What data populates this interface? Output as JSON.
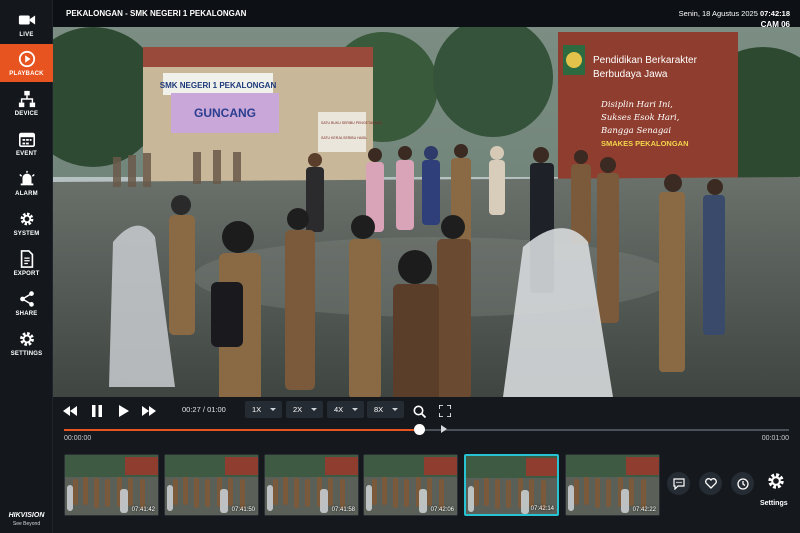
{
  "sidebar": {
    "items": [
      {
        "label": "LIVE",
        "icon": "video-camera-icon"
      },
      {
        "label": "PLAYBACK",
        "icon": "play-circle-icon",
        "active": true
      },
      {
        "label": "DEVICE",
        "icon": "network-device-icon"
      },
      {
        "label": "EVENT",
        "icon": "calendar-icon"
      },
      {
        "label": "ALARM",
        "icon": "alarm-bell-icon"
      },
      {
        "label": "SYSTEM",
        "icon": "system-gear-icon"
      },
      {
        "label": "EXPORT",
        "icon": "document-export-icon"
      },
      {
        "label": "SHARE",
        "icon": "share-icon"
      },
      {
        "label": "SETTINGS",
        "icon": "settings-gear-icon"
      }
    ],
    "brand": {
      "name": "HIKVISION",
      "tagline": "See Beyond"
    },
    "active_color": "#e8541f"
  },
  "header": {
    "title": "PEKALONGAN - SMK NEGERI 1 PEKALONGAN",
    "date": "Senin, 18 Agustus 2025",
    "time": "07:42:18",
    "camera": "CAM 06"
  },
  "scene": {
    "banner_school": "SMK NEGERI 1 PEKALONGAN",
    "banner_event": "GUNCANG",
    "sign_small_1": "SATU BUKU SERIBU PENGETAHUAN",
    "sign_small_2": "SATU KERJA SERIBU HASIL",
    "wall_line1": "Pendidikan Berkarakter",
    "wall_line2": "Berbudaya Jawa",
    "wall_motto1": "Disiplin Hari Ini,",
    "wall_motto2": "Sukses Esok Hari,",
    "wall_motto3": "Bangga Senagai",
    "wall_motto4": "SMAKES PEKALONGAN"
  },
  "player": {
    "current_time": "00:27",
    "separator": "/",
    "duration": "01:00",
    "progress": 0.49,
    "marker_position": 0.52,
    "speeds": [
      "1X",
      "2X",
      "4X",
      "8X"
    ],
    "timeline_start": "00:00:00",
    "timeline_end": "00:01:00",
    "controls": [
      "rewind-icon",
      "pause-icon",
      "play-icon",
      "fast-forward-icon",
      "zoom-icon",
      "fullscreen-icon"
    ]
  },
  "thumbnails": [
    {
      "time": "07:41:42"
    },
    {
      "time": "07:41:50"
    },
    {
      "time": "07:41:58"
    },
    {
      "time": "07:42:06"
    },
    {
      "time": "07:42:14",
      "selected": true
    },
    {
      "time": "07:42:22"
    }
  ],
  "actions": {
    "buttons": [
      "comment-icon",
      "heart-icon",
      "clock-icon"
    ],
    "settings_label": "Settings",
    "selected_color": "#27c3d3"
  }
}
